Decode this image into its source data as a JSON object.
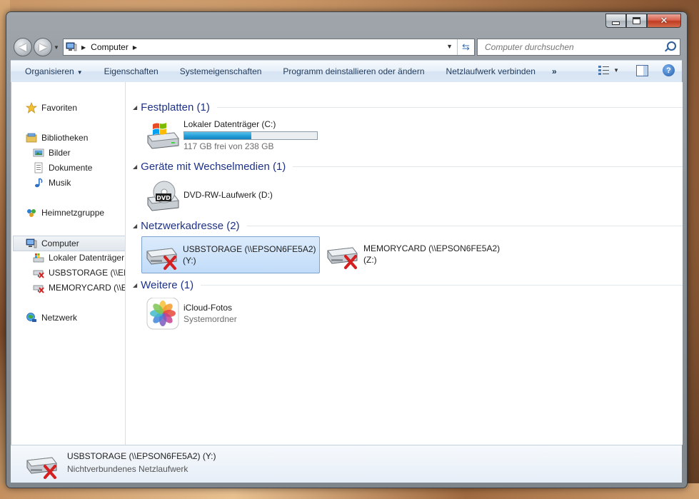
{
  "window": {
    "controls": {
      "minimize": "–",
      "maximize": "□",
      "close": "✕"
    }
  },
  "nav": {
    "address_path": "Computer",
    "search_placeholder": "Computer durchsuchen"
  },
  "toolbar": {
    "organize": "Organisieren",
    "properties": "Eigenschaften",
    "system_properties": "Systemeigenschaften",
    "uninstall": "Programm deinstallieren oder ändern",
    "map_drive": "Netzlaufwerk verbinden",
    "more": "»"
  },
  "sidebar": {
    "items": [
      {
        "label": "Favoriten",
        "icon": "star-icon"
      },
      {
        "label": "Bibliotheken",
        "icon": "libraries-icon"
      },
      {
        "label": "Bilder",
        "icon": "pictures-icon"
      },
      {
        "label": "Dokumente",
        "icon": "documents-icon"
      },
      {
        "label": "Musik",
        "icon": "music-icon"
      },
      {
        "label": "Heimnetzgruppe",
        "icon": "homegroup-icon"
      },
      {
        "label": "Computer",
        "icon": "computer-icon"
      },
      {
        "label": "Lokaler Datenträger",
        "icon": "local-disk-icon"
      },
      {
        "label": "USBSTORAGE (\\\\EPS",
        "icon": "network-drive-disconnected-icon"
      },
      {
        "label": "MEMORYCARD (\\\\E",
        "icon": "network-drive-disconnected-icon"
      },
      {
        "label": "Netzwerk",
        "icon": "network-icon"
      }
    ]
  },
  "groups": [
    {
      "title": "Festplatten (1)",
      "items": [
        {
          "name": "Lokaler Datenträger (C:)",
          "subtitle": "117 GB frei von 238 GB",
          "usage_fraction": 0.508,
          "icon": "windows-hard-drive-icon"
        }
      ]
    },
    {
      "title": "Geräte mit Wechselmedien (1)",
      "items": [
        {
          "name": "DVD-RW-Laufwerk (D:)",
          "icon": "dvd-drive-icon",
          "icon_label": "DVD"
        }
      ]
    },
    {
      "title": "Netzwerkadresse (2)",
      "items": [
        {
          "name": "USBSTORAGE (\\\\EPSON6FE5A2)",
          "subtitle": "(Y:)",
          "icon": "network-drive-disconnected-icon",
          "selected": true
        },
        {
          "name": "MEMORYCARD (\\\\EPSON6FE5A2)",
          "subtitle": "(Z:)",
          "icon": "network-drive-disconnected-icon"
        }
      ]
    },
    {
      "title": "Weitere (1)",
      "items": [
        {
          "name": "iCloud-Fotos",
          "subtitle": "Systemordner",
          "icon": "icloud-photos-icon"
        }
      ]
    }
  ],
  "details": {
    "name": "USBSTORAGE (\\\\EPSON6FE5A2) (Y:)",
    "subtitle": "Nichtverbundenes Netzlaufwerk"
  },
  "colors": {
    "group_title": "#1e3287",
    "selection": "#c1dcf9",
    "capacity_bar": "#26a0da"
  }
}
